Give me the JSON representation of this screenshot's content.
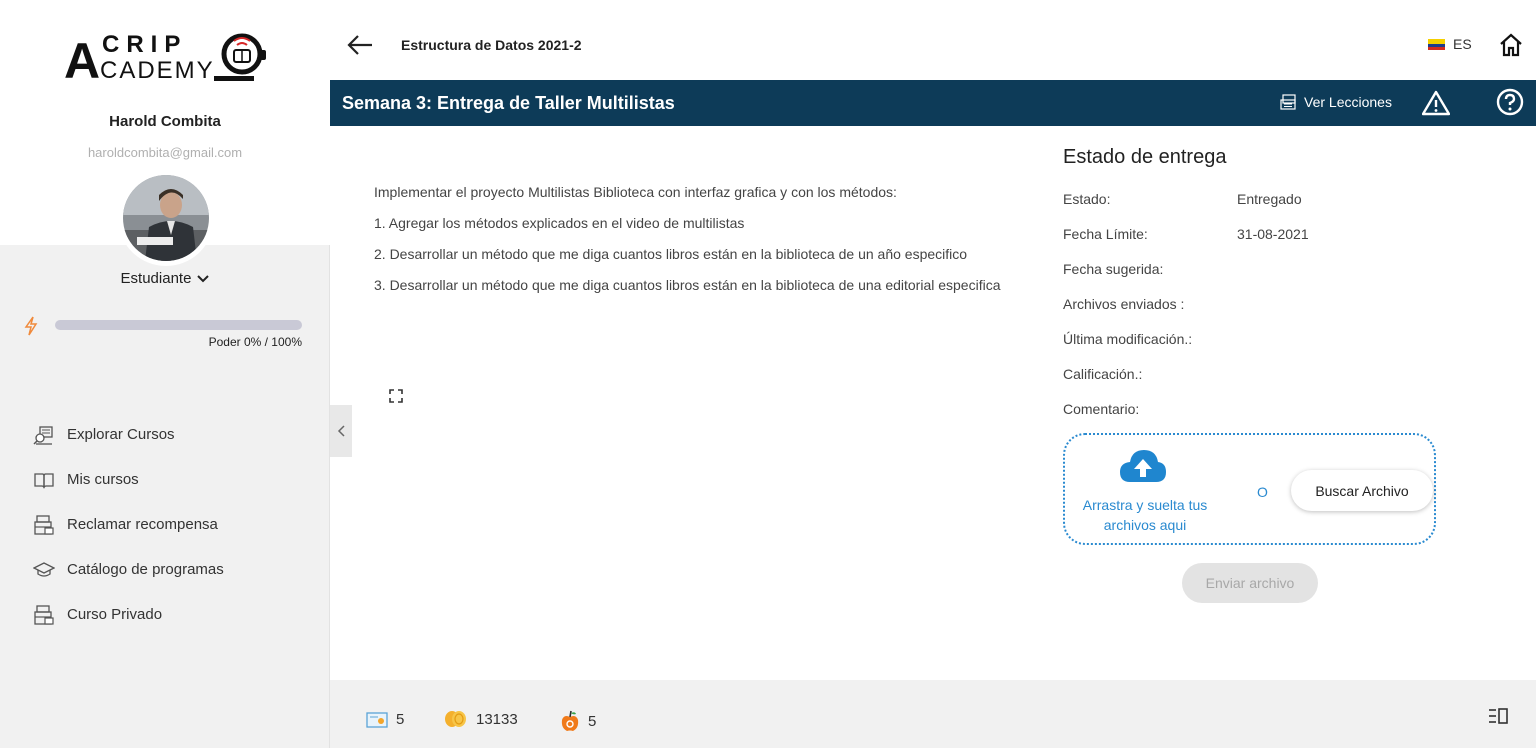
{
  "brand": {
    "logo_top": "ACRIP",
    "logo_bottom": "CADEMY",
    "accent": "#0d3b58",
    "link_color": "#2a8ad0"
  },
  "user": {
    "name": "Harold Combita",
    "email": "haroldcombita@gmail.com",
    "role": "Estudiante"
  },
  "power": {
    "label": "Poder 0% / 100%",
    "value": 0
  },
  "sidebar": {
    "items": [
      {
        "label": "Explorar Cursos",
        "icon": "explore-courses-icon"
      },
      {
        "label": "Mis cursos",
        "icon": "book-icon"
      },
      {
        "label": "Reclamar recompensa",
        "icon": "reward-icon"
      },
      {
        "label": "Catálogo de programas",
        "icon": "graduation-cap-icon"
      },
      {
        "label": "Curso Privado",
        "icon": "private-course-icon"
      }
    ]
  },
  "header": {
    "course_title": "Estructura de Datos 2021-2",
    "language": "ES"
  },
  "banner": {
    "title": "Semana 3: Entrega de Taller Multilistas",
    "lessons_label": "Ver Lecciones"
  },
  "task": {
    "paragraphs": [
      "Implementar el proyecto Multilistas Biblioteca con interfaz grafica y con los métodos:",
      "1. Agregar los métodos explicados en el video de multilistas",
      "2. Desarrollar un método que me diga cuantos libros están en la biblioteca de un año especifico",
      "3. Desarrollar un método que me diga cuantos libros están en la biblioteca de una editorial especifica"
    ]
  },
  "submission": {
    "title": "Estado de entrega",
    "rows": [
      {
        "key": "Estado:",
        "value": "Entregado"
      },
      {
        "key": "Fecha Límite:",
        "value": "31-08-2021"
      },
      {
        "key": "Fecha sugerida:",
        "value": ""
      },
      {
        "key": "Archivos enviados :",
        "value": ""
      },
      {
        "key": "Última modificación.:",
        "value": ""
      },
      {
        "key": "Calificación.:",
        "value": ""
      },
      {
        "key": "Comentario:",
        "value": ""
      }
    ],
    "drop_text": "Arrastra y suelta tus archivos aqui",
    "or_label": "O",
    "browse_label": "Buscar Archivo",
    "send_label": "Enviar archivo"
  },
  "footer": {
    "stats": [
      {
        "value": "5",
        "icon": "certificate-icon"
      },
      {
        "value": "13133",
        "icon": "coins-icon"
      },
      {
        "value": "5",
        "icon": "apple-icon"
      }
    ]
  }
}
